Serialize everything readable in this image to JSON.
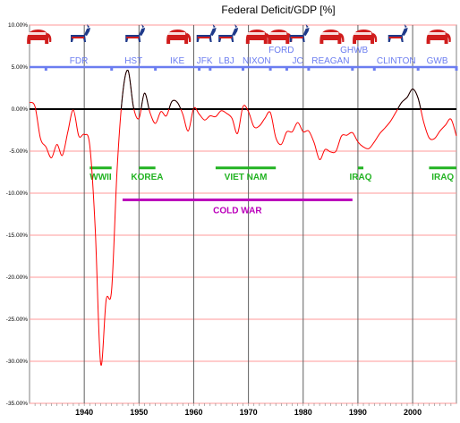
{
  "chart_data": {
    "type": "line",
    "title": "Federal Deficit/GDP [%]",
    "xlabel": "",
    "ylabel": "",
    "xlim": [
      1930,
      2008
    ],
    "ylim": [
      -35,
      10
    ],
    "x_ticks": [
      1940,
      1950,
      1960,
      1970,
      1980,
      1990,
      2000
    ],
    "y_ticks": [
      "10.00%",
      "5.00%",
      "0.00%",
      "-5.00%",
      "-10.00%",
      "-15.00%",
      "-20.00%",
      "-25.00%",
      "-30.00%",
      "-35.00%"
    ],
    "grid": true,
    "series": [
      {
        "color": "#ff0000",
        "x": [
          1930,
          1931,
          1932,
          1933,
          1934,
          1935,
          1936,
          1937,
          1938,
          1939,
          1940,
          1941,
          1942,
          1943,
          1944,
          1945,
          1946,
          1947,
          1948,
          1949,
          1950,
          1951,
          1952,
          1953,
          1954,
          1955,
          1956,
          1957,
          1958,
          1959,
          1960,
          1961,
          1962,
          1963,
          1964,
          1965,
          1966,
          1967,
          1968,
          1969,
          1970,
          1971,
          1972,
          1973,
          1974,
          1975,
          1976,
          1977,
          1978,
          1979,
          1980,
          1981,
          1982,
          1983,
          1984,
          1985,
          1986,
          1987,
          1988,
          1989,
          1990,
          1991,
          1992,
          1993,
          1994,
          1995,
          1996,
          1997,
          1998,
          1999,
          2000,
          2001,
          2002,
          2003,
          2004,
          2005,
          2006,
          2007,
          2008
        ],
        "y": [
          0.8,
          0.3,
          -3.5,
          -4.5,
          -5.8,
          -4.2,
          -5.5,
          -2.7,
          -0.1,
          -3.2,
          -3.0,
          -4.3,
          -14.2,
          -30.3,
          -22.7,
          -21.5,
          -7.2,
          1.7,
          4.6,
          0.2,
          -1.1,
          1.9,
          -0.4,
          -1.7,
          -0.3,
          -0.8,
          0.9,
          0.8,
          -0.6,
          -2.6,
          0.1,
          -0.6,
          -1.3,
          -0.8,
          -0.9,
          -0.2,
          -0.5,
          -1.1,
          -2.9,
          0.3,
          -0.3,
          -2.1,
          -2.0,
          -1.1,
          -0.4,
          -3.4,
          -4.2,
          -2.7,
          -2.7,
          -1.6,
          -2.7,
          -2.6,
          -4.0,
          -6.0,
          -4.8,
          -5.1,
          -5.0,
          -3.2,
          -3.1,
          -2.8,
          -3.9,
          -4.5,
          -4.7,
          -3.9,
          -2.9,
          -2.2,
          -1.4,
          -0.3,
          0.8,
          1.4,
          2.4,
          1.3,
          -1.5,
          -3.4,
          -3.5,
          -2.6,
          -1.9,
          -1.2,
          -3.2
        ]
      }
    ],
    "presidents": [
      {
        "label": "FDR",
        "start": 1933,
        "end": 1945,
        "party": "D"
      },
      {
        "label": "HST",
        "start": 1945,
        "end": 1953,
        "party": "D"
      },
      {
        "label": "IKE",
        "start": 1953,
        "end": 1961,
        "party": "R"
      },
      {
        "label": "JFK",
        "start": 1961,
        "end": 1963,
        "party": "D"
      },
      {
        "label": "LBJ",
        "start": 1963,
        "end": 1969,
        "party": "D"
      },
      {
        "label": "NIXON",
        "start": 1969,
        "end": 1974,
        "party": "R"
      },
      {
        "label": "FORD",
        "start": 1974,
        "end": 1977,
        "party": "R"
      },
      {
        "label": "JC",
        "start": 1977,
        "end": 1981,
        "party": "D"
      },
      {
        "label": "REAGAN",
        "start": 1981,
        "end": 1989,
        "party": "R"
      },
      {
        "label": "GHWB",
        "start": 1989,
        "end": 1993,
        "party": "R"
      },
      {
        "label": "CLINTON",
        "start": 1993,
        "end": 2001,
        "party": "D"
      },
      {
        "label": "GWB",
        "start": 2001,
        "end": 2008,
        "party": "R"
      }
    ],
    "wars": [
      {
        "label": "WWII",
        "start": 1941,
        "end": 1945,
        "y": -7
      },
      {
        "label": "KOREA",
        "start": 1950,
        "end": 1953,
        "y": -7
      },
      {
        "label": "VIET NAM",
        "start": 1964,
        "end": 1975,
        "y": -7
      },
      {
        "label": "IRAQ",
        "start": 1990,
        "end": 1991,
        "y": -7
      },
      {
        "label": "IRAQ",
        "start": 2003,
        "end": 2008,
        "y": -7
      }
    ],
    "cold_war": {
      "label": "COLD WAR",
      "start": 1947,
      "end": 1989,
      "y": -10.8
    },
    "colors": {
      "deficit": "#ff0000",
      "zero_line": "#000000",
      "grid_h": "#ff9999",
      "grid_v": "#606060",
      "presidents": "#6b7df0",
      "wars": "#22b322",
      "cold_war": "#bb00bb",
      "republican": "#d01c1c",
      "democrat": "#1f3a8a"
    }
  }
}
